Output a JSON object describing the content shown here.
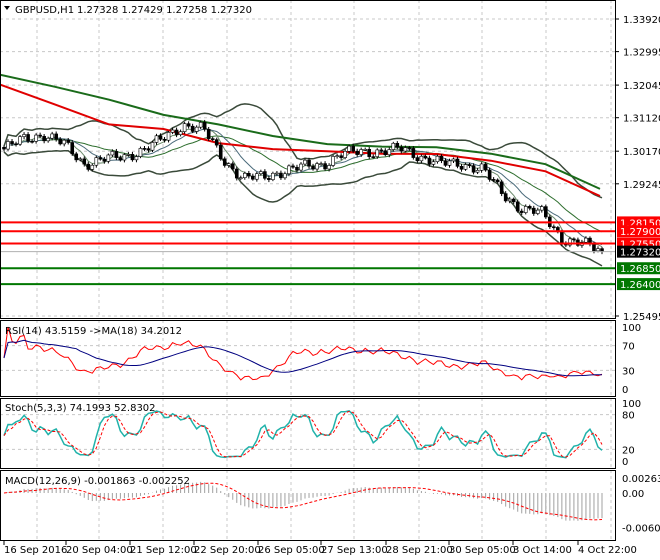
{
  "header": {
    "symbol": "GBPUSD,H1",
    "ohlc": "1.27328 1.27429 1.27258 1.27320"
  },
  "rsi": {
    "label": "RSI(14) 43.5159  ->MA(18) 34.2012",
    "ticks": [
      "100",
      "70",
      "30",
      "0"
    ]
  },
  "stoch": {
    "label": "Stoch(5,3,3) 74.1993 52.8302",
    "ticks": [
      "100",
      "80",
      "20",
      "0"
    ]
  },
  "macd": {
    "label": "MACD(12,26,9) -0.001863 -0.002252",
    "ticks": [
      "0.002634",
      "0.00",
      "-0.006057"
    ]
  },
  "colors": {
    "support": "#007700",
    "resistance": "#ff0000",
    "ma_fast": "#e00000",
    "ma_slow": "#1a6b1a",
    "rsi": "#ff0000",
    "rsi_ma": "#000080",
    "stoch_main": "#20b2aa",
    "stoch_signal": "#ff0000",
    "macd_hist": "#a0a0a0"
  },
  "chart_data": {
    "type": "candlestick",
    "symbol": "GBPUSD",
    "timeframe": "H1",
    "price_ticks": [
      "1.33920",
      "1.32995",
      "1.32045",
      "1.31120",
      "1.30170",
      "1.29245",
      "1.25495"
    ],
    "ylim": [
      1.25495,
      1.3392
    ],
    "time_ticks": [
      "16 Sep 2016",
      "20 Sep 04:00",
      "21 Sep 12:00",
      "22 Sep 20:00",
      "26 Sep 05:00",
      "27 Sep 13:00",
      "28 Sep 21:00",
      "30 Sep 05:00",
      "3 Oct 14:00",
      "4 Oct 22:00"
    ],
    "close_path": [
      1.3023,
      1.3051,
      1.3065,
      1.3037,
      1.2981,
      1.2995,
      1.3,
      1.3023,
      1.3051,
      1.3093,
      1.3079,
      1.2995,
      1.2939,
      1.2944,
      1.2961,
      1.2972,
      1.2981,
      1.3009,
      1.3017,
      1.3017,
      1.3023,
      1.3,
      1.2981,
      1.2981,
      1.2967,
      1.2896,
      1.2854,
      1.284,
      1.2769,
      1.2755,
      1.2732
    ],
    "ma_red": [
      1.3206,
      1.315,
      1.3093,
      1.308,
      1.304,
      1.3023,
      1.3017,
      1.301,
      1.3009,
      1.299,
      1.296,
      1.289
    ],
    "ma_green": [
      1.3234,
      1.32,
      1.3163,
      1.312,
      1.3093,
      1.306,
      1.3037,
      1.303,
      1.3028,
      1.301,
      1.298,
      1.291
    ],
    "levels": [
      {
        "price": "1.28150",
        "kind": "resistance"
      },
      {
        "price": "1.27900",
        "kind": "resistance"
      },
      {
        "price": "1.27550",
        "kind": "resistance"
      },
      {
        "price": "1.26850",
        "kind": "support"
      },
      {
        "price": "1.26400",
        "kind": "support"
      }
    ],
    "last_price": "1.27320"
  }
}
